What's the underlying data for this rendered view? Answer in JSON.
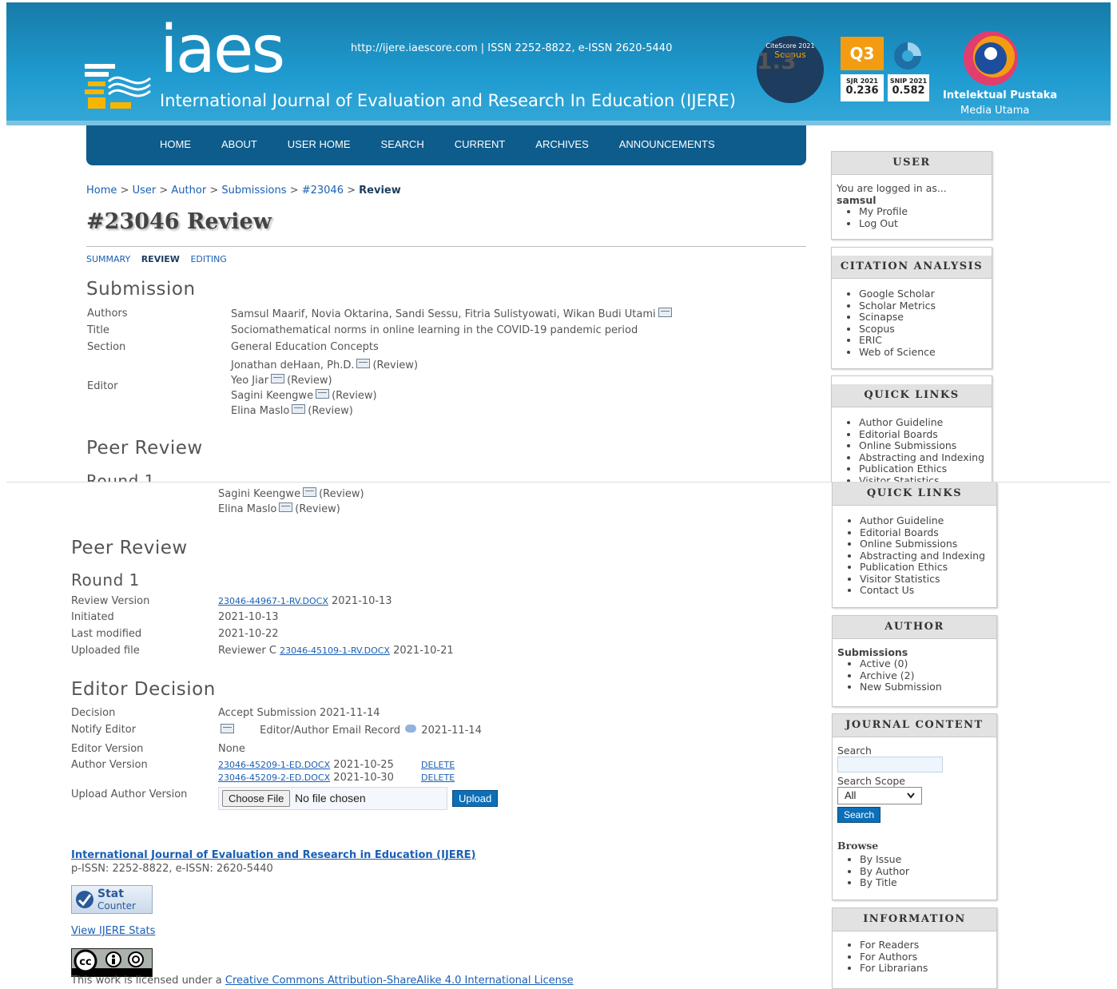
{
  "banner": {
    "logo_word": "iaes",
    "journal_full": "International Journal of Evaluation and Research In Education (IJERE)",
    "issn_line": "http://ijere.iaescore.com  |  ISSN 2252-8822, e-ISSN 2620-5440",
    "citescore": {
      "label": "CiteScore 2021",
      "value": "1.3",
      "source": "Scopus"
    },
    "quartile": "Q3",
    "sjr": {
      "label": "SJR 2021",
      "value": "0.236"
    },
    "snip": {
      "label": "SNIP 2021",
      "value": "0.582"
    },
    "publisher": {
      "name": "Intelektual Pustaka",
      "sub": "Media Utama"
    }
  },
  "nav": [
    "HOME",
    "ABOUT",
    "USER HOME",
    "SEARCH",
    "CURRENT",
    "ARCHIVES",
    "ANNOUNCEMENTS"
  ],
  "breadcrumb": {
    "items": [
      "Home",
      "User",
      "Author",
      "Submissions",
      "#23046"
    ],
    "current": "Review",
    "sep": ">"
  },
  "page_title": "#23046 Review",
  "subtabs": {
    "summary": "SUMMARY",
    "review": "REVIEW",
    "editing": "EDITING"
  },
  "submission": {
    "heading": "Submission",
    "authors_label": "Authors",
    "authors": "Samsul Maarif, Novia Oktarina, Sandi Sessu, Fitria Sulistyowati, Wikan Budi Utami",
    "title_label": "Title",
    "title": "Sociomathematical norms in online learning in the COVID-19 pandemic period",
    "section_label": "Section",
    "section": "General Education Concepts",
    "editor_label": "Editor",
    "editors": [
      {
        "name": "Jonathan deHaan, Ph.D.",
        "role": "(Review)"
      },
      {
        "name": "Yeo Jiar",
        "role": "(Review)"
      },
      {
        "name": "Sagini Keengwe",
        "role": "(Review)"
      },
      {
        "name": "Elina Maslo",
        "role": "(Review)"
      }
    ]
  },
  "peer_review": {
    "heading": "Peer Review",
    "round": "Round 1",
    "review_version_label": "Review Version",
    "review_version_file": "23046-44967-1-RV.DOCX",
    "review_version_date": "2021-10-13",
    "initiated_label": "Initiated",
    "initiated": "2021-10-13",
    "last_modified_label": "Last modified",
    "last_modified": "2021-10-22",
    "uploaded_label": "Uploaded file",
    "uploaded_reviewer": "Reviewer C",
    "uploaded_file": "23046-45109-1-RV.DOCX",
    "uploaded_date": "2021-10-21"
  },
  "editor_decision": {
    "heading": "Editor Decision",
    "decision_label": "Decision",
    "decision": "Accept Submission 2021-11-14",
    "notify_label": "Notify Editor",
    "notify_text": "Editor/Author Email Record",
    "notify_date": "2021-11-14",
    "editor_version_label": "Editor Version",
    "editor_version": "None",
    "author_version_label": "Author Version",
    "author_versions": [
      {
        "file": "23046-45209-1-ED.DOCX",
        "date": "2021-10-25",
        "action": "DELETE"
      },
      {
        "file": "23046-45209-2-ED.DOCX",
        "date": "2021-10-30",
        "action": "DELETE"
      }
    ],
    "upload_label": "Upload Author Version",
    "choose_file": "Choose File",
    "no_file": "No file chosen",
    "upload_button": "Upload"
  },
  "footer": {
    "journal_link": "International Journal of Evaluation and Research in Education (IJERE)",
    "issn": "p-ISSN: 2252-8822, e-ISSN: 2620-5440",
    "statcounter_top": "Stat",
    "statcounter_bottom": "Counter",
    "stats_link": "View IJERE Stats",
    "license_prefix": "This work is licensed under a ",
    "license_link": "Creative Commons Attribution-ShareAlike 4.0 International License"
  },
  "sidebar": {
    "user": {
      "title": "USER",
      "logged_in": "You are logged in as...",
      "username": "samsul",
      "links": [
        "My Profile",
        "Log Out"
      ]
    },
    "citation": {
      "title": "CITATION ANALYSIS",
      "links": [
        "Google Scholar",
        "Scholar Metrics",
        "Scinapse",
        "Scopus",
        "ERIC",
        "Web of Science"
      ]
    },
    "quick_links": {
      "title": "QUICK LINKS",
      "links": [
        "Author Guideline",
        "Editorial Boards",
        "Online Submissions",
        "Abstracting and Indexing",
        "Publication Ethics",
        "Visitor Statistics",
        "Contact Us"
      ]
    },
    "author": {
      "title": "AUTHOR",
      "submissions": "Submissions",
      "links": [
        {
          "label": "Active",
          "count": "(0)"
        },
        {
          "label": "Archive",
          "count": "(2)"
        },
        {
          "label": "New Submission",
          "count": ""
        }
      ]
    },
    "journal_content": {
      "title": "JOURNAL CONTENT",
      "search_label": "Search",
      "scope_label": "Search Scope",
      "scope_value": "All",
      "search_button": "Search",
      "browse": "Browse",
      "browse_links": [
        "By Issue",
        "By Author",
        "By Title"
      ]
    },
    "information": {
      "title": "INFORMATION",
      "links": [
        "For Readers",
        "For Authors",
        "For Librarians"
      ]
    }
  },
  "colors": {
    "banner": "#1f9bd0",
    "nav": "#0d5c8c",
    "link": "#1a5fb4",
    "accent": "#f39c12"
  }
}
